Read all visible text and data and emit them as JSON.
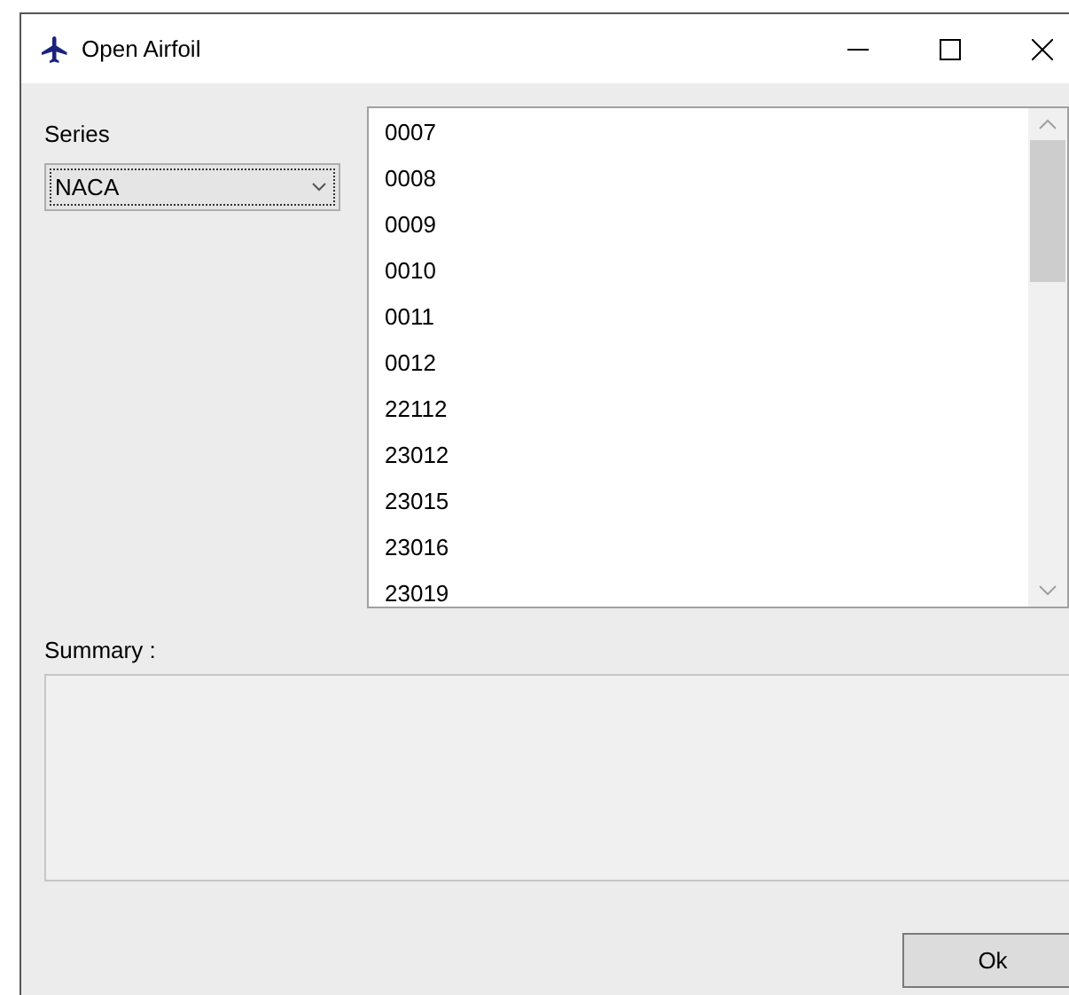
{
  "window": {
    "title": "Open Airfoil"
  },
  "series": {
    "label": "Series",
    "value": "NACA",
    "focused": true
  },
  "airfoils": [
    "0007",
    "0008",
    "0009",
    "0010",
    "0011",
    "0012",
    "22112",
    "23012",
    "23015",
    "23016",
    "23019"
  ],
  "summary": {
    "label": "Summary :"
  },
  "buttons": [
    "Ok"
  ]
}
